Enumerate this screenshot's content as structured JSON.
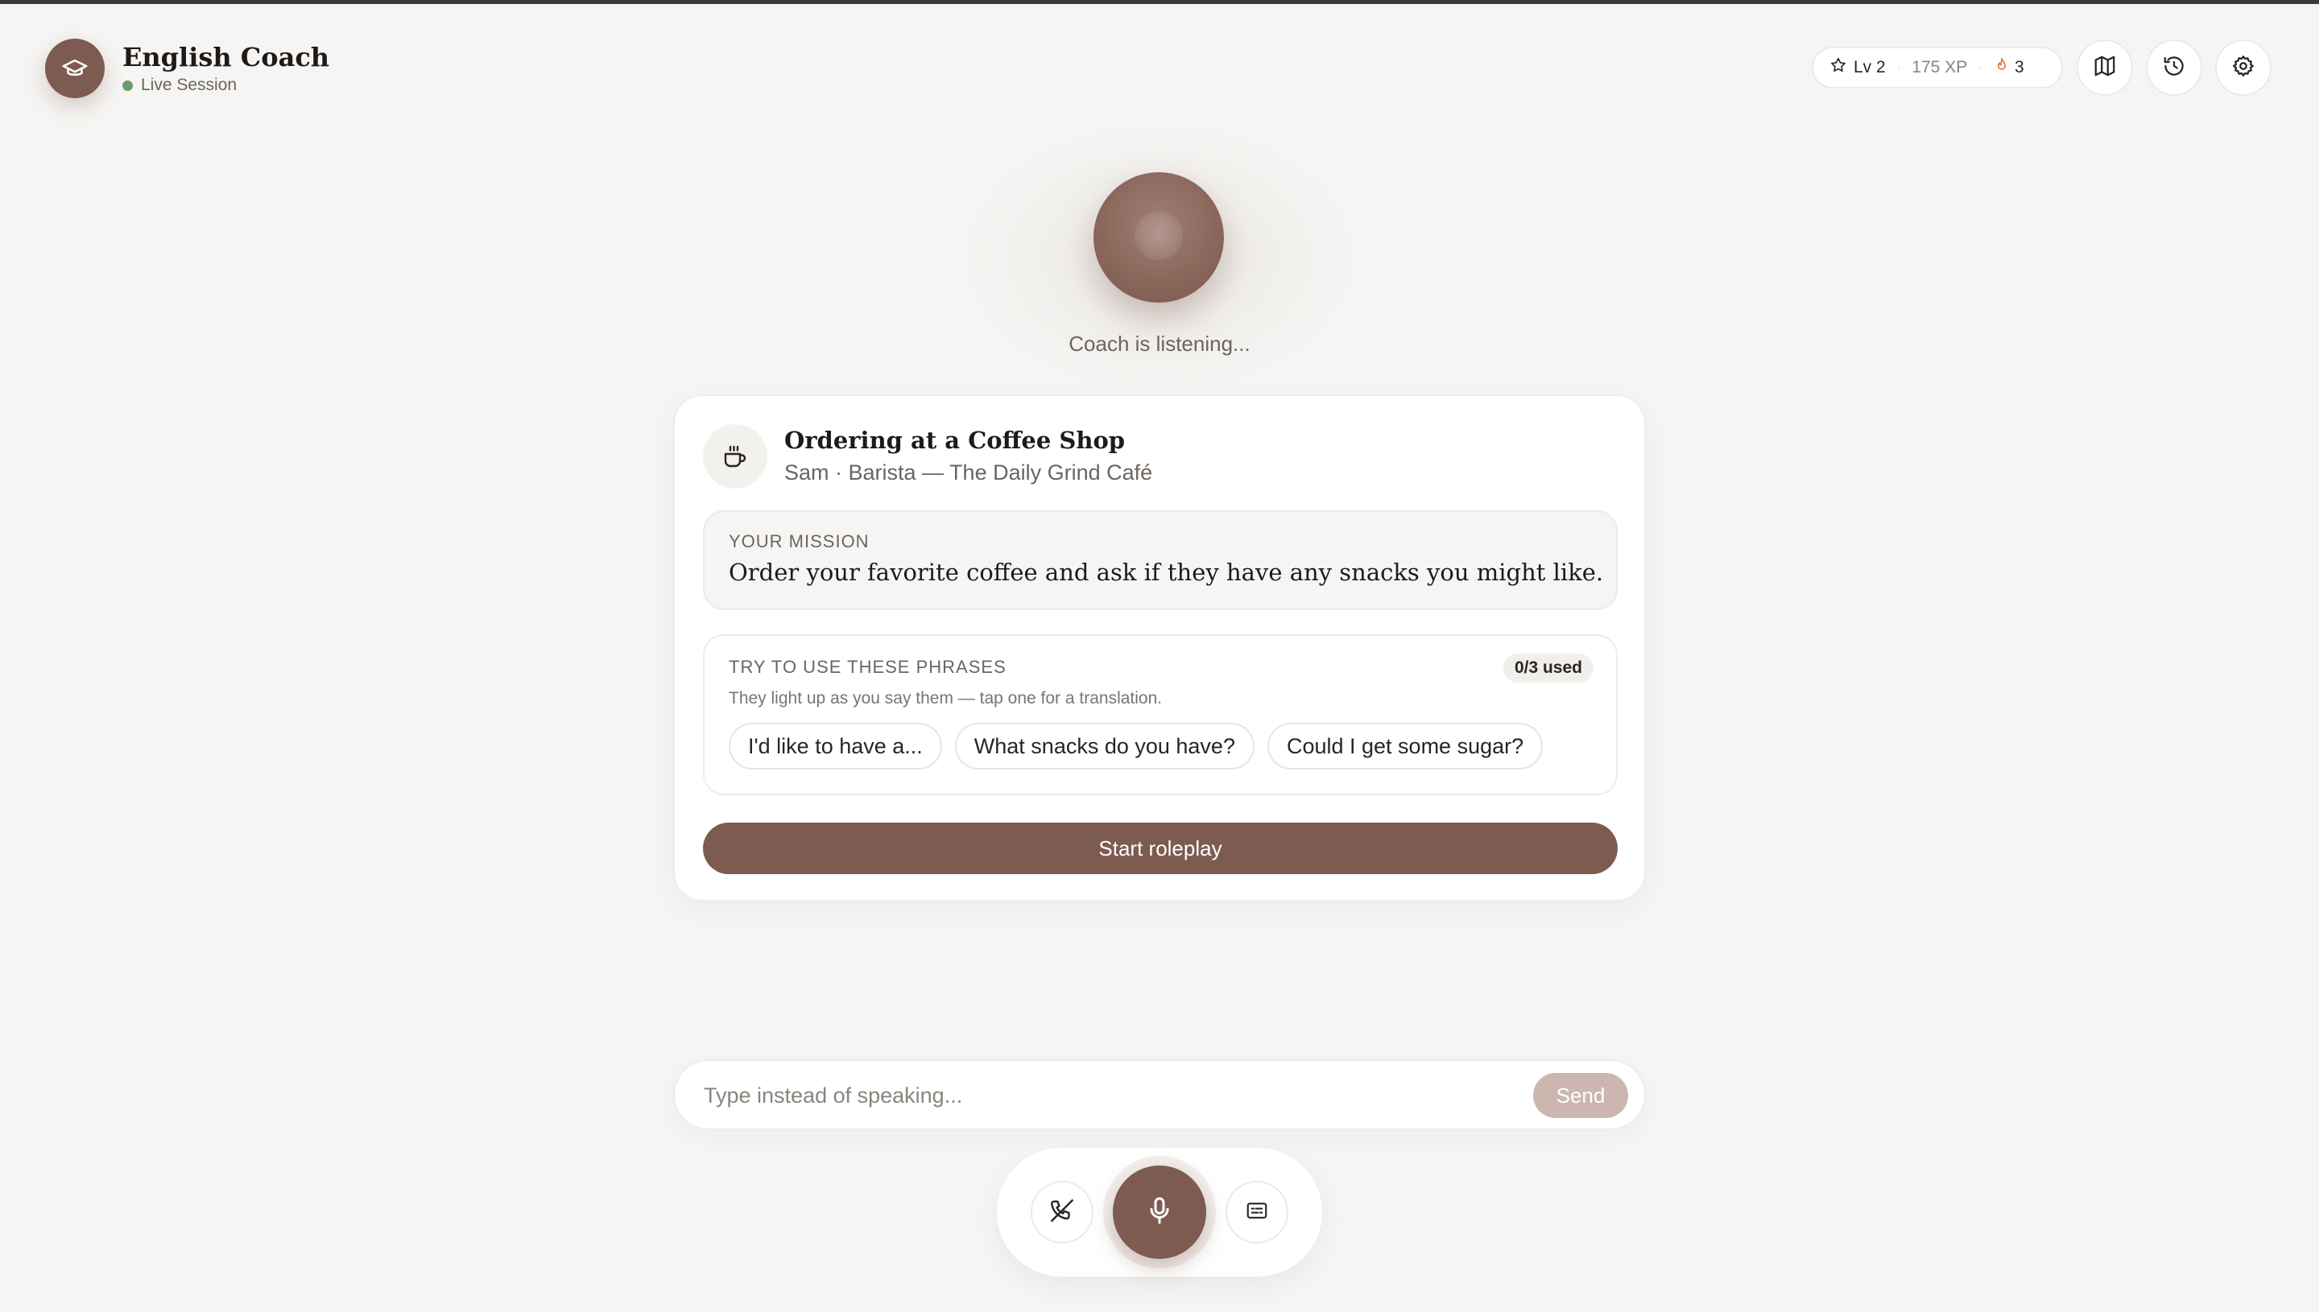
{
  "header": {
    "title": "English Coach",
    "status": "Live Session"
  },
  "stats": {
    "level": "Lv 2",
    "xp": "175 XP",
    "streak": "3"
  },
  "header_buttons": {
    "map_icon": "map-icon",
    "history_icon": "history-icon",
    "settings_icon": "gear-icon"
  },
  "coach": {
    "status_text": "Coach is listening..."
  },
  "scenario": {
    "icon": "coffee-cup-icon",
    "title": "Ordering at a Coffee Shop",
    "subtitle": "Sam · Barista — The Daily Grind Café",
    "mission_label": "YOUR MISSION",
    "mission_text": "Order your favorite coffee and ask if they have any snacks you might like.",
    "phrases_label": "TRY TO USE THESE PHRASES",
    "phrases_counter": "0/3 used",
    "phrases_hint": "They light up as you say them — tap one for a translation.",
    "phrases": [
      "I'd like to have a...",
      "What snacks do you have?",
      "Could I get some sugar?"
    ],
    "start_label": "Start roleplay"
  },
  "input": {
    "placeholder": "Type instead of speaking...",
    "value": "",
    "send_label": "Send"
  },
  "controls": {
    "end_call_icon": "phone-off-icon",
    "mic_icon": "microphone-icon",
    "captions_icon": "captions-icon"
  },
  "colors": {
    "accent": "#7d5b50",
    "background": "#f6f5f3",
    "live_dot": "#6f9a6a",
    "streak": "#e07b3a",
    "send_disabled": "#cbb7b0"
  }
}
